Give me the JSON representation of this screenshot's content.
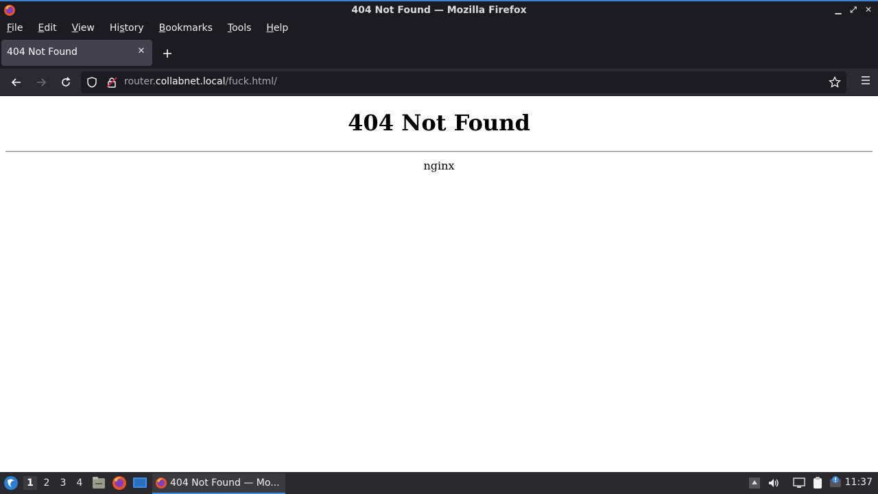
{
  "window": {
    "title": "404 Not Found — Mozilla Firefox"
  },
  "menubar": {
    "items": [
      {
        "label": "File",
        "accel": "F",
        "rest": "ile"
      },
      {
        "label": "Edit",
        "accel": "E",
        "rest": "dit"
      },
      {
        "label": "View",
        "accel": "V",
        "rest": "iew"
      },
      {
        "label": "History",
        "pre": "Hi",
        "accel": "s",
        "rest": "tory"
      },
      {
        "label": "Bookmarks",
        "accel": "B",
        "rest": "ookmarks"
      },
      {
        "label": "Tools",
        "accel": "T",
        "rest": "ools"
      },
      {
        "label": "Help",
        "accel": "H",
        "rest": "elp"
      }
    ]
  },
  "tabs": [
    {
      "title": "404 Not Found",
      "active": true
    }
  ],
  "urlbar": {
    "prefix": "router.",
    "domain": "collabnet.local",
    "path": "/fuck.html/"
  },
  "page": {
    "heading": "404 Not Found",
    "server": "nginx"
  },
  "taskbar": {
    "workspaces": [
      "1",
      "2",
      "3",
      "4"
    ],
    "active_workspace": "1",
    "task_label": "404 Not Found — Mo...",
    "clock": "11:37"
  },
  "colors": {
    "chrome_dark": "#1c1b22",
    "toolbar": "#2b2a33",
    "tab_active": "#42414d",
    "taskbar": "#2a2a2e",
    "accent": "#3d8ee6"
  }
}
